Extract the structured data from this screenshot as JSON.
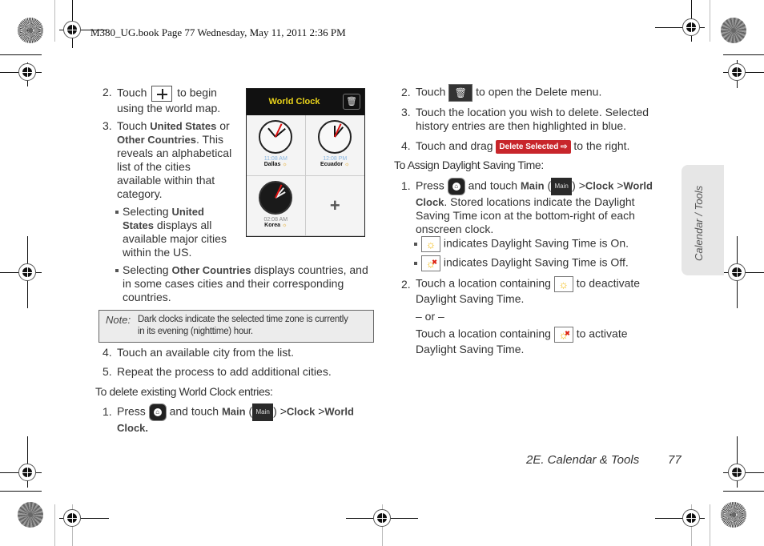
{
  "header": {
    "print_line": "M380_UG.book  Page 77  Wednesday, May 11, 2011  2:36 PM"
  },
  "left_column": {
    "step2": {
      "num": "2.",
      "pre": "Touch",
      "icon": "plus-icon",
      "post": "to begin",
      "line2": "using the world map."
    },
    "step3": {
      "num": "3.",
      "pre": "Touch",
      "b1": "United States",
      "mid": "or",
      "b2": "Other Countries",
      "line3": ". This",
      "lines": [
        "reveals an alphabetical",
        "list of the cities",
        "available within that",
        "category."
      ]
    },
    "bullet_us": {
      "pre": "Selecting",
      "b": "United",
      "b2": "States",
      "rest1": "displays all",
      "lines": [
        "available major cities",
        "within the US."
      ]
    },
    "bullet_other": {
      "pre": "Selecting",
      "b": "Other Countries",
      "rest1": "displays countries, and",
      "lines": [
        "in some cases cities and their corresponding",
        "countries."
      ]
    },
    "note": {
      "label": "Note:",
      "line1": "Dark clocks indicate the selected time zone is currently",
      "line2": "in its evening (nighttime) hour."
    },
    "step4": {
      "num": "4.",
      "text": "Touch an available city from the list."
    },
    "step5": {
      "num": "5.",
      "text": "Repeat the process to add additional cities."
    },
    "delete_heading": "To delete existing World Clock entries:",
    "del_step1": {
      "num": "1.",
      "pre": "Press",
      "mid": "and touch",
      "b_main": "Main",
      "main_icon": "Main",
      "sep": ">",
      "b_clock": "Clock",
      "b_world": "World",
      "b_clock2": "Clock."
    }
  },
  "phone": {
    "title": "World Clock",
    "trash": "🗑",
    "clocks": [
      {
        "time": "11:08 AM",
        "city": "Dallas",
        "dark": false
      },
      {
        "time": "12:08 PM",
        "city": "Ecuador",
        "dark": false
      },
      {
        "time": "02:08 AM",
        "city": "Korea",
        "dark": true
      }
    ],
    "add": "+"
  },
  "right_column": {
    "step2": {
      "num": "2.",
      "pre": "Touch",
      "post": "to open the Delete menu."
    },
    "step3": {
      "num": "3.",
      "line1": "Touch the location you wish to delete. Selected",
      "line2": "history entries are then highlighted in blue."
    },
    "step4": {
      "num": "4.",
      "pre": "Touch and drag",
      "button": "Delete Selected ⇨",
      "post": "to the right."
    },
    "dst_heading": "To Assign Daylight Saving Time:",
    "dst_step1": {
      "num": "1.",
      "pre": "Press",
      "mid": "and touch",
      "b_main": "Main",
      "main_icon": "Main",
      "sep": ">",
      "b_clock": "Clock",
      "b_world": "World",
      "b_clock2": "Clock",
      "rest": ". Stored locations indicate the Daylight",
      "lines": [
        "Saving Time icon at the bottom-right of each",
        "onscreen clock."
      ]
    },
    "dst_on": "indicates Daylight Saving Time is On.",
    "dst_off": "indicates Daylight Saving Time is Off.",
    "dst_step2": {
      "num": "2.",
      "pre": "Touch a location containing",
      "post": "to deactivate",
      "line2": "Daylight Saving Time."
    },
    "or": "– or –",
    "activate": {
      "pre": "Touch a location containing",
      "post": "to activate",
      "line2": "Daylight Saving Time."
    }
  },
  "side_tab": "Calendar / Tools",
  "footer": {
    "section": "2E. Calendar & Tools",
    "page": "77"
  },
  "icons": {
    "sun": "☼",
    "x": "✖"
  }
}
